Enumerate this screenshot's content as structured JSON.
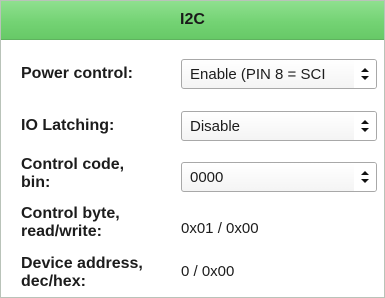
{
  "header": {
    "title": "I2C"
  },
  "rows": {
    "power_control": {
      "label": "Power control:",
      "value": "Enable (PIN 8 = SCI"
    },
    "io_latching": {
      "label": "IO Latching:",
      "value": "Disable"
    },
    "control_code": {
      "label_line1": "Control code,",
      "label_line2": "bin:",
      "value": "0000"
    },
    "control_byte": {
      "label_line1": "Control byte,",
      "label_line2": "read/write:",
      "value": "0x01 / 0x00"
    },
    "device_address": {
      "label_line1": "Device address,",
      "label_line2": "dec/hex:",
      "value": "0 / 0x00"
    }
  },
  "icons": {
    "select_arrow": "up-down-chevron-icon"
  },
  "colors": {
    "header_green": "#74d374",
    "border": "#a8a8a8"
  }
}
